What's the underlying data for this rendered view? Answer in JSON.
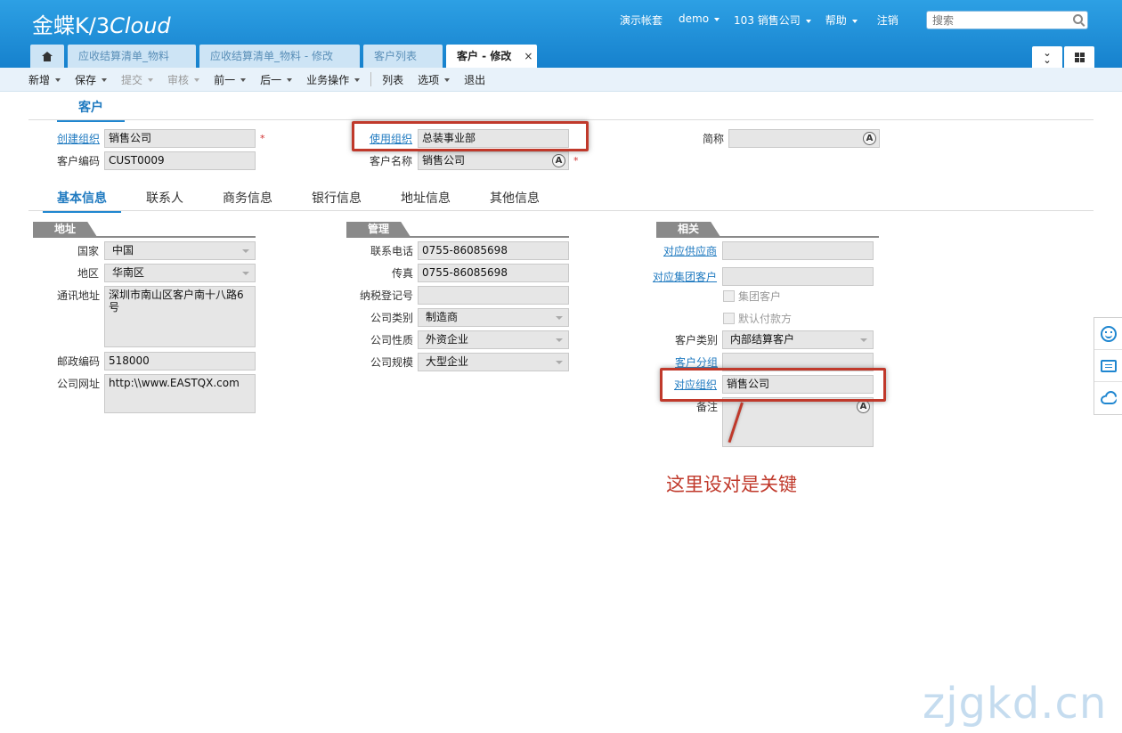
{
  "app": {
    "logo_main": "金蝶K/3",
    "logo_cloud": "Cloud"
  },
  "topnav": {
    "demo_account": "演示帐套",
    "user": "demo",
    "org": "103 销售公司",
    "help": "帮助",
    "logout": "注销"
  },
  "search": {
    "placeholder": "搜索"
  },
  "tabs": [
    {
      "label": "应收结算清单_物料"
    },
    {
      "label": "应收结算清单_物料 - 修改"
    },
    {
      "label": "客户列表"
    },
    {
      "label": "客户 - 修改",
      "close": "×"
    }
  ],
  "toolbar": {
    "new": "新增",
    "save": "保存",
    "submit": "提交",
    "audit": "审核",
    "prev": "前一",
    "next": "后一",
    "business": "业务操作",
    "list": "列表",
    "options": "选项",
    "exit": "退出"
  },
  "section_title": "客户",
  "header_fields": {
    "create_org_label": "创建组织",
    "create_org_value": "销售公司",
    "use_org_label": "使用组织",
    "use_org_value": "总装事业部",
    "short_name_label": "简称",
    "short_name_value": "",
    "code_label": "客户编码",
    "code_value": "CUST0009",
    "name_label": "客户名称",
    "name_value": "销售公司",
    "required_mark": "*",
    "ml_icon": "A"
  },
  "subtabs": [
    "基本信息",
    "联系人",
    "商务信息",
    "银行信息",
    "地址信息",
    "其他信息"
  ],
  "groups": {
    "address": "地址",
    "manage": "管理",
    "related": "相关"
  },
  "address": {
    "country_label": "国家",
    "country_value": "中国",
    "region_label": "地区",
    "region_value": "华南区",
    "addr_label": "通讯地址",
    "addr_value": "深圳市南山区客户南十八路6号",
    "zip_label": "邮政编码",
    "zip_value": "518000",
    "web_label": "公司网址",
    "web_value": "http:\\\\www.EASTQX.com"
  },
  "manage": {
    "phone_label": "联系电话",
    "phone_value": "0755-86085698",
    "fax_label": "传真",
    "fax_value": "0755-86085698",
    "tax_label": "纳税登记号",
    "tax_value": "",
    "ctype_label": "公司类别",
    "ctype_value": "制造商",
    "cnature_label": "公司性质",
    "cnature_value": "外资企业",
    "cscale_label": "公司规模",
    "cscale_value": "大型企业"
  },
  "related": {
    "supplier_label": "对应供应商",
    "supplier_value": "",
    "group_cust_label": "对应集团客户",
    "group_cust_value": "",
    "is_group_label": "集团客户",
    "default_payer_label": "默认付款方",
    "cust_type_label": "客户类别",
    "cust_type_value": "内部结算客户",
    "cust_group_label": "客户分组",
    "cust_group_value": "",
    "corr_org_label": "对应组织",
    "corr_org_value": "销售公司",
    "remark_label": "备注",
    "remark_value": ""
  },
  "annotation": "这里设对是关键",
  "watermark": "zjgkd.cn",
  "colors": {
    "header_blue": "#1f86d0",
    "annotation_red": "#c0392b"
  }
}
